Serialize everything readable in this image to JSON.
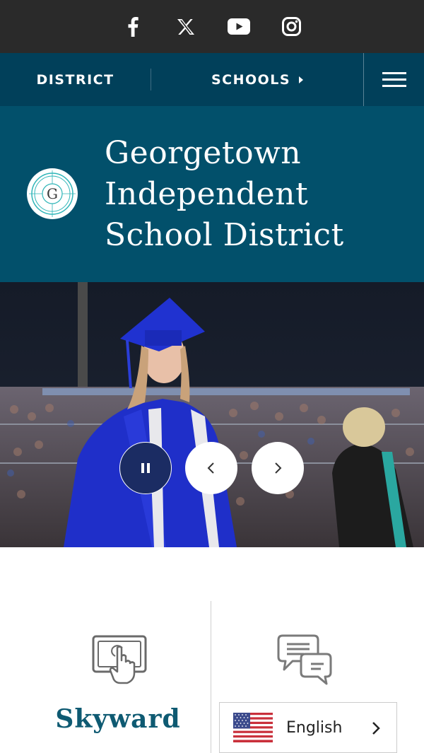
{
  "social": {
    "icons": [
      "facebook-icon",
      "x-icon",
      "youtube-icon",
      "instagram-icon"
    ],
    "background": "#2a2a2a"
  },
  "nav": {
    "district_label": "DISTRICT",
    "schools_label": "SCHOOLS",
    "menu_icon": "hamburger-icon",
    "background": "#01405a"
  },
  "header": {
    "title": "Georgetown Independent School District",
    "logo_letter": "G",
    "logo_ring_text": "GEORGETOWN ISD",
    "background": "#02506b"
  },
  "hero": {
    "pause_icon": "pause-icon",
    "prev_icon": "chevron-left-icon",
    "next_icon": "chevron-right-icon",
    "pause_color": "#1b2c63"
  },
  "quick_links": {
    "skyward_label": "Skyward",
    "skyward_icon": "touchscreen-hand-icon",
    "second_icon": "chat-bubbles-icon",
    "label_color": "#0e5a72"
  },
  "language": {
    "current": "English",
    "flag_icon": "us-flag-icon",
    "chevron_icon": "chevron-right-icon"
  }
}
